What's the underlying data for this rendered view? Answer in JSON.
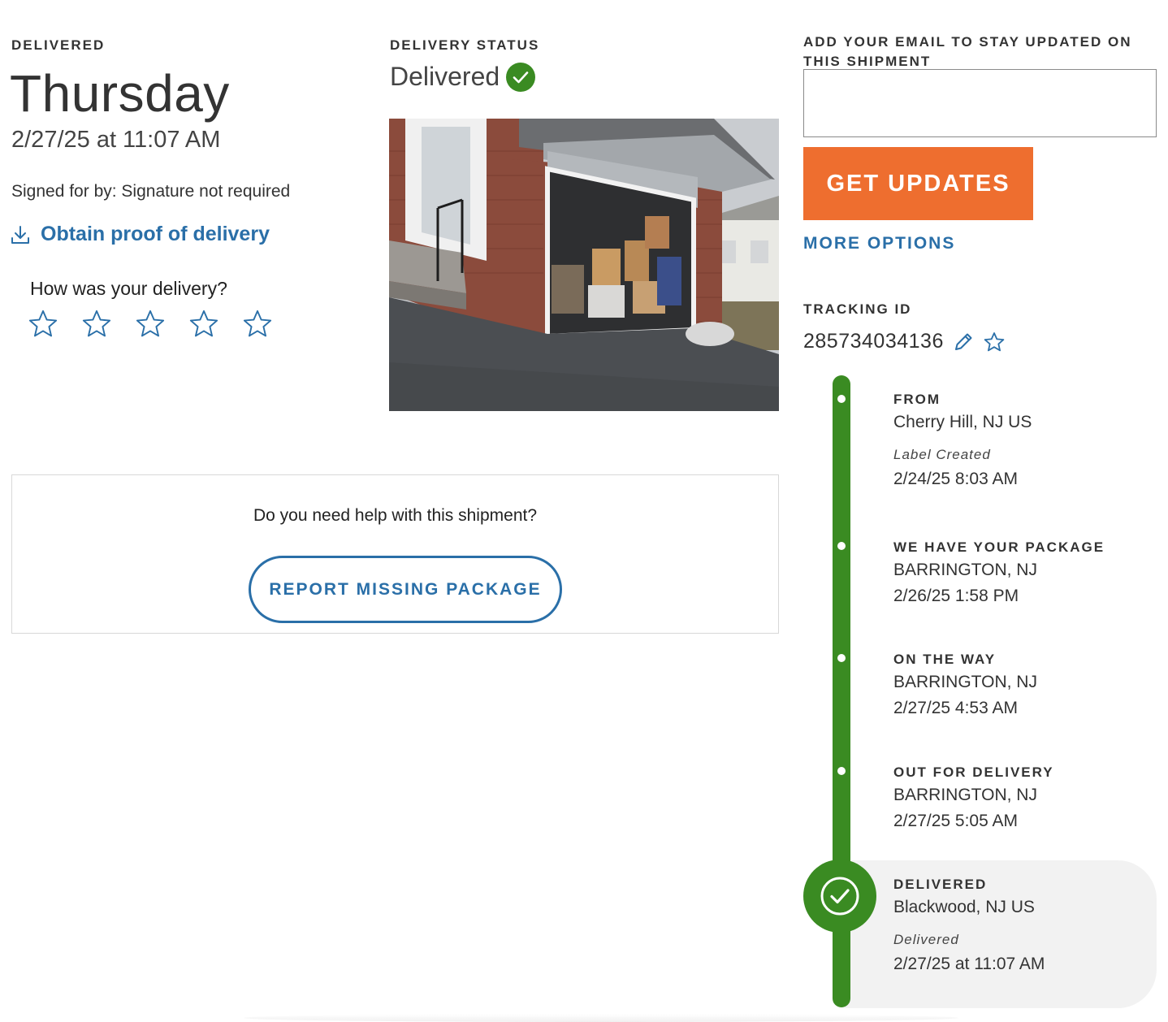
{
  "summary": {
    "delivered_label": "DELIVERED",
    "day": "Thursday",
    "datetime": "2/27/25 at 11:07 AM",
    "signed_for": "Signed for by: Signature not required",
    "proof_link": "Obtain proof of delivery",
    "rating_question": "How was your delivery?",
    "rating_max": 5,
    "rating_value": 0
  },
  "status": {
    "label": "DELIVERY STATUS",
    "text": "Delivered"
  },
  "help": {
    "question": "Do you need help with this shipment?",
    "report_button": "REPORT MISSING PACKAGE"
  },
  "email": {
    "label": "ADD YOUR EMAIL TO STAY UPDATED ON THIS SHIPMENT",
    "value": "",
    "placeholder": "",
    "button": "GET UPDATES",
    "more_options": "MORE OPTIONS"
  },
  "tracking": {
    "label": "TRACKING ID",
    "number": "285734034136"
  },
  "timeline": [
    {
      "title": "FROM",
      "location": "Cherry Hill, NJ US",
      "note": "Label Created",
      "time": "2/24/25 8:03 AM"
    },
    {
      "title": "WE HAVE YOUR PACKAGE",
      "location": "BARRINGTON, NJ",
      "time": "2/26/25 1:58 PM"
    },
    {
      "title": "ON THE WAY",
      "location": "BARRINGTON, NJ",
      "time": "2/27/25 4:53 AM"
    },
    {
      "title": "OUT FOR DELIVERY",
      "location": "BARRINGTON, NJ",
      "time": "2/27/25 5:05 AM"
    },
    {
      "title": "DELIVERED",
      "location": "Blackwood, NJ US",
      "note": "Delivered",
      "time": "2/27/25 at 11:07 AM"
    }
  ],
  "colors": {
    "accent_blue": "#2a6fa8",
    "accent_orange": "#ee6e2f",
    "success_green": "#3a8b22"
  },
  "icons": {
    "download": "download-icon",
    "star": "star-outline-icon",
    "check": "check-circle-icon",
    "edit": "pencil-icon",
    "favorite": "star-outline-icon"
  }
}
